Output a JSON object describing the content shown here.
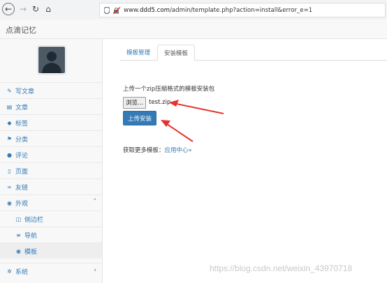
{
  "browser": {
    "url_prefix": "www.",
    "url_domain": "ddd5.com",
    "url_path": "/admin/template.php?action=install&error_e=1"
  },
  "app": {
    "title": "点滴记忆"
  },
  "sidebar": {
    "items": [
      {
        "label": "写文章",
        "icon": "pencil-icon"
      },
      {
        "label": "文章",
        "icon": "list-icon"
      },
      {
        "label": "标签",
        "icon": "tag-icon"
      },
      {
        "label": "分类",
        "icon": "flag-icon"
      },
      {
        "label": "评论",
        "icon": "comment-icon"
      },
      {
        "label": "页面",
        "icon": "file-icon"
      },
      {
        "label": "友链",
        "icon": "link-icon"
      },
      {
        "label": "外观",
        "icon": "eye-icon"
      },
      {
        "label": "侧边栏",
        "icon": "columns-icon"
      },
      {
        "label": "导航",
        "icon": "bars-icon"
      },
      {
        "label": "模板",
        "icon": "eye-icon"
      },
      {
        "label": "系统",
        "icon": "gear-icon"
      }
    ]
  },
  "tabs": {
    "manage": "模板管理",
    "install": "安装模板"
  },
  "install": {
    "hint": "上传一个zip压缩格式的模板安装包",
    "browse_label": "浏览...",
    "file_name": "test.zip",
    "upload_label": "上传安装",
    "more_prefix": "获取更多模板：",
    "more_link": "应用中心»"
  },
  "watermark": "https://blog.csdn.net/weixin_43970718",
  "colors": {
    "accent": "#337ab7",
    "annotation": "#e8322d"
  }
}
